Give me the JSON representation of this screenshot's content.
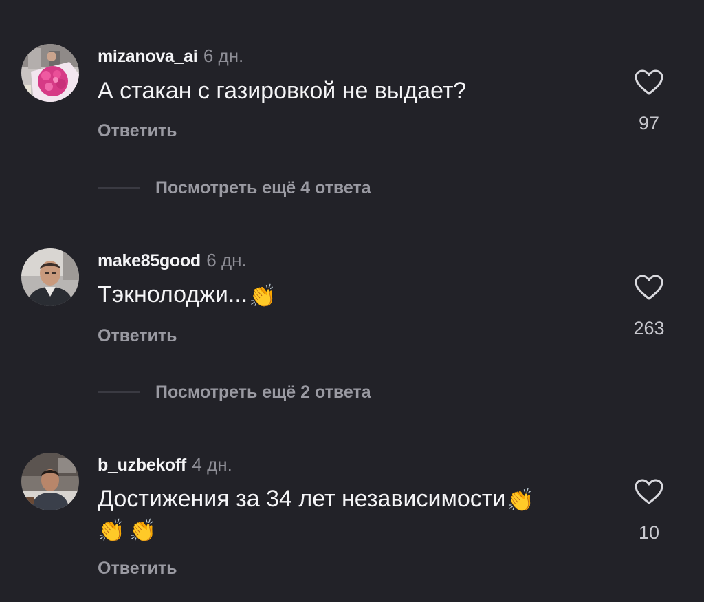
{
  "comments": [
    {
      "username": "mizanova_ai",
      "time": "6 дн.",
      "text": "А стакан с газировкой не выдает?",
      "text_emoji": "",
      "text_line2": "",
      "reply_label": "Ответить",
      "likes": "97",
      "more_replies": "Посмотреть ещё 4 ответа"
    },
    {
      "username": "make85good",
      "time": "6 дн.",
      "text": "Тэкнолоджи...",
      "text_emoji": "👏",
      "text_line2": "",
      "reply_label": "Ответить",
      "likes": "263",
      "more_replies": "Посмотреть ещё 2 ответа"
    },
    {
      "username": "b_uzbekoff",
      "time": "4 дн.",
      "text": "Достижения за 34 лет независимости",
      "text_emoji": "👏",
      "text_line2": "👏👏",
      "reply_label": "Ответить",
      "likes": "10",
      "more_replies": ""
    }
  ],
  "icons": {
    "like": "heart-outline-icon"
  },
  "colors": {
    "background": "#222228",
    "primary_text": "#f5f5f7",
    "secondary_text": "#9a9aa2",
    "avatar_1_accent": "#e0428e"
  }
}
